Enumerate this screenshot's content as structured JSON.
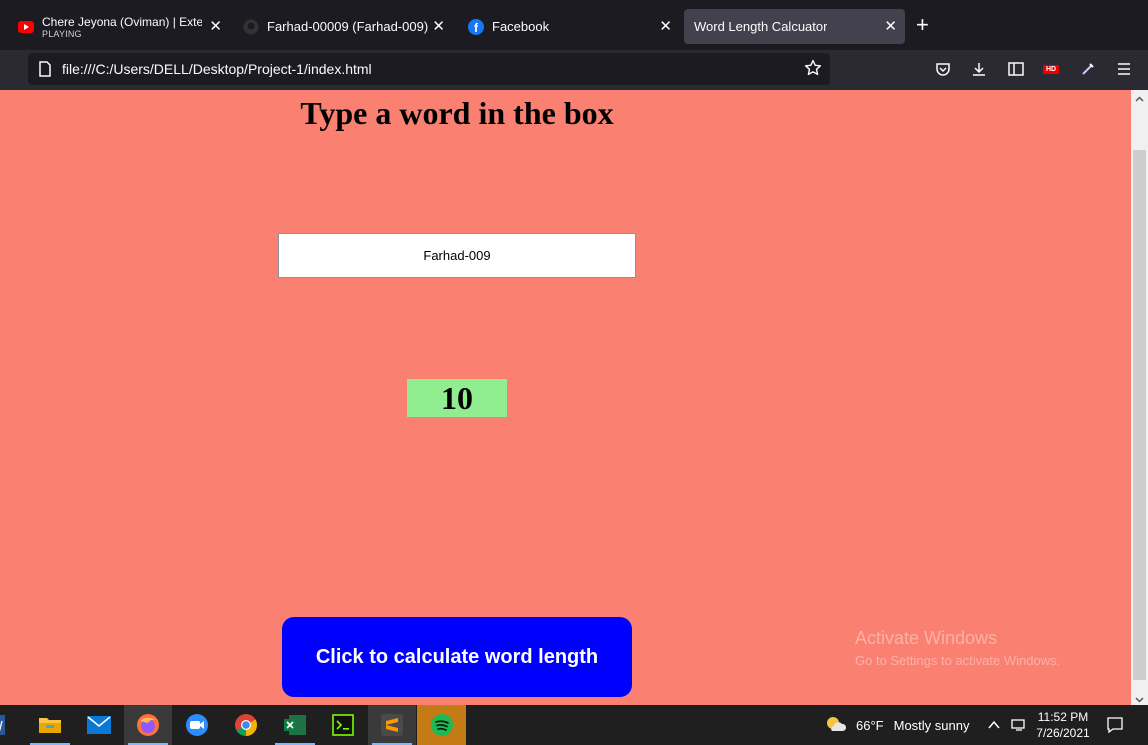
{
  "browser": {
    "tabs": [
      {
        "title": "Chere Jeyona (Oviman) | Extend",
        "subtitle": "PLAYING",
        "icon": "youtube-icon"
      },
      {
        "title": "Farhad-00009 (Farhad-009)",
        "icon": "github-icon"
      },
      {
        "title": "Facebook",
        "icon": "facebook-icon"
      },
      {
        "title": "Word Length Calcuator",
        "icon": "none",
        "active": true
      }
    ],
    "url": "file:///C:/Users/DELL/Desktop/Project-1/index.html",
    "hd_badge": "HD"
  },
  "page": {
    "heading": "Type a word in the box",
    "input_value": "Farhad-009",
    "result": "10",
    "button_label": "Click to calculate word length",
    "background_color": "#fa8072",
    "result_color": "#90ee90",
    "button_color": "#0000ff"
  },
  "watermark": {
    "line1": "Activate Windows",
    "line2": "Go to Settings to activate Windows."
  },
  "taskbar": {
    "apps": [
      "word-icon",
      "file-explorer-icon",
      "mail-icon",
      "firefox-icon",
      "zoom-icon",
      "chrome-icon",
      "excel-icon",
      "terminal-icon",
      "sublime-text-icon",
      "spotify-icon"
    ],
    "weather_temp": "66°F",
    "weather_condition": "Mostly sunny",
    "time": "11:52 PM",
    "date": "7/26/2021"
  }
}
